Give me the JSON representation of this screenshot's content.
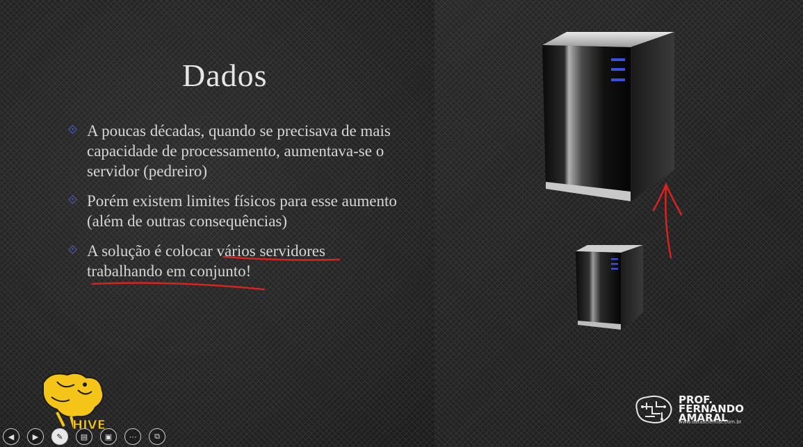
{
  "slide": {
    "title": "Dados",
    "bullets": [
      "A poucas décadas, quando se precisava de mais capacidade de processamento, aumentava-se o servidor (pedreiro)",
      "Porém existem limites físicos para esse aumento (além de outras consequências)",
      "A solução é colocar vários servidores trabalhando em conjunto!"
    ]
  },
  "logo": {
    "hive_text": "HIVE"
  },
  "brand": {
    "line1": "PROF.",
    "line2": "FERNANDO",
    "line3": "AMARAL",
    "url": "www.datascientist.com.br"
  },
  "controls": [
    {
      "name": "previous-slide-button",
      "icon": "◀"
    },
    {
      "name": "next-slide-button",
      "icon": "▶"
    },
    {
      "name": "pen-tool-button",
      "icon": "✎"
    },
    {
      "name": "subtitles-button",
      "icon": "▤"
    },
    {
      "name": "slide-overview-button",
      "icon": "▣"
    },
    {
      "name": "more-options-button",
      "icon": "⋯"
    },
    {
      "name": "presenter-view-button",
      "icon": "⧉"
    }
  ],
  "colors": {
    "accent": "#4a5fd0",
    "annotation": "#d8231f",
    "hive_yellow": "#f4c518"
  }
}
